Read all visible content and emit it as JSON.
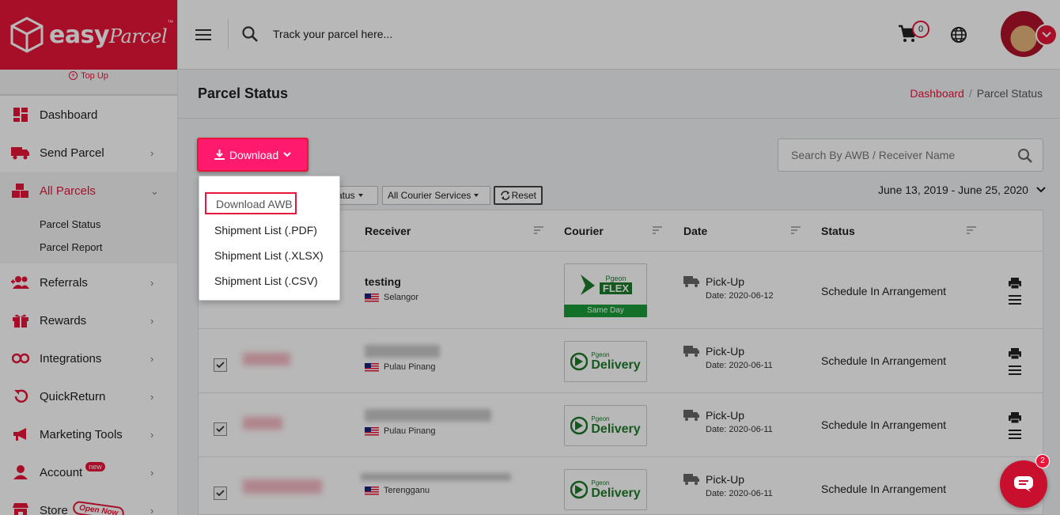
{
  "brand": {
    "name": "easy",
    "script": "Parcel",
    "tm": "™"
  },
  "sidebar": {
    "top_up": "Top Up",
    "items": [
      {
        "label": "Dashboard",
        "icon": "dashboard-icon"
      },
      {
        "label": "Send Parcel",
        "icon": "truck-icon"
      },
      {
        "label": "All Parcels",
        "icon": "boxes-icon"
      },
      {
        "label": "Referrals",
        "icon": "users-plus-icon"
      },
      {
        "label": "Rewards",
        "icon": "gift-icon"
      },
      {
        "label": "Integrations",
        "icon": "link-icon"
      },
      {
        "label": "QuickReturn",
        "icon": "return-icon"
      },
      {
        "label": "Marketing Tools",
        "icon": "megaphone-icon"
      },
      {
        "label": "Account",
        "icon": "user-icon",
        "badge": "new"
      },
      {
        "label": "Store",
        "icon": "store-icon",
        "badge": "Open Now"
      }
    ],
    "sub_items": [
      "Parcel Status",
      "Parcel Report"
    ]
  },
  "header": {
    "track_placeholder": "Track your parcel here...",
    "cart_count": "0"
  },
  "page": {
    "title": "Parcel Status",
    "breadcrumb": [
      "Dashboard",
      "/",
      "Parcel Status"
    ]
  },
  "toolbar": {
    "download_label": "Download",
    "search_placeholder": "Search By AWB / Receiver Name",
    "status_filter": "atus",
    "courier_filter": "All Courier Services",
    "reset_label": "Reset",
    "date_range": "June 13, 2019 - June 25, 2020"
  },
  "download_menu": [
    "Download AWB",
    "Shipment List (.PDF)",
    "Shipment List (.XLSX)",
    "Shipment List (.CSV)"
  ],
  "table": {
    "columns": [
      "Receiver",
      "Courier",
      "Date",
      "Status"
    ],
    "rows": [
      {
        "receiver": "testing",
        "state": "Selangor",
        "courier": "Pgeon FLEX",
        "courier_tag": "Same Day",
        "date_label": "Pick-Up",
        "date": "Date: 2020-06-12",
        "status": "Schedule In Arrangement"
      },
      {
        "receiver": "",
        "state": "Pulau Pinang",
        "courier": "Pgeon Delivery",
        "date_label": "Pick-Up",
        "date": "Date: 2020-06-11",
        "status": "Schedule In Arrangement"
      },
      {
        "receiver": "",
        "state": "Pulau Pinang",
        "courier": "Pgeon Delivery",
        "date_label": "Pick-Up",
        "date": "Date: 2020-06-11",
        "status": "Schedule In Arrangement"
      },
      {
        "receiver": "",
        "state": "Terengganu",
        "courier": "Pgeon Delivery",
        "date_label": "Pick-Up",
        "date": "Date: 2020-06-11",
        "status": "Schedule In Arrangement"
      }
    ]
  },
  "chat": {
    "unread": "2"
  },
  "colors": {
    "brand": "#e8163a",
    "button": "#ff1a6e",
    "courier_green": "#1d7a2a"
  }
}
